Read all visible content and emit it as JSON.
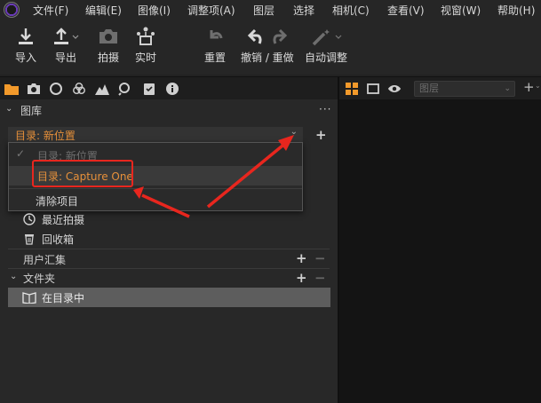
{
  "menu": {
    "items": [
      "文件(F)",
      "编辑(E)",
      "图像(I)",
      "调整项(A)",
      "图层",
      "选择",
      "相机(C)",
      "查看(V)",
      "视窗(W)",
      "帮助(H)"
    ]
  },
  "toolbar": {
    "import_label": "导入",
    "export_label": "导出",
    "capture_label": "拍摄",
    "live_label": "实时",
    "reset_label": "重置",
    "undo_redo_label": "撤销 / 重做",
    "auto_adjust_label": "自动调整"
  },
  "tool_tabs": [
    "folder-icon",
    "camera-icon",
    "lens-icon",
    "color-icon",
    "exposure-icon",
    "search-icon",
    "details-icon",
    "info-icon"
  ],
  "right_panel": {
    "layer_select_placeholder": "图层",
    "layer_add": "+"
  },
  "library": {
    "title": "图库",
    "more": "···",
    "catalog_select_value": "目录: 新位置",
    "add": "+"
  },
  "dropdown": {
    "items": [
      {
        "label": "目录: 新位置",
        "checked": true,
        "disabled": true
      },
      {
        "label": "目录: Capture One",
        "highlighted": true
      },
      {
        "label": "清除项目"
      }
    ]
  },
  "library_items": {
    "recent_captures": "最近拍摄",
    "trash": "回收箱"
  },
  "user_collections": {
    "title": "用户汇集",
    "add": "+",
    "remove": "−"
  },
  "folders": {
    "title": "文件夹",
    "add": "+",
    "remove": "−",
    "in_catalog": "在目录中"
  },
  "colors": {
    "accent_orange": "#e6903a",
    "annotation_red": "#e8261e"
  }
}
